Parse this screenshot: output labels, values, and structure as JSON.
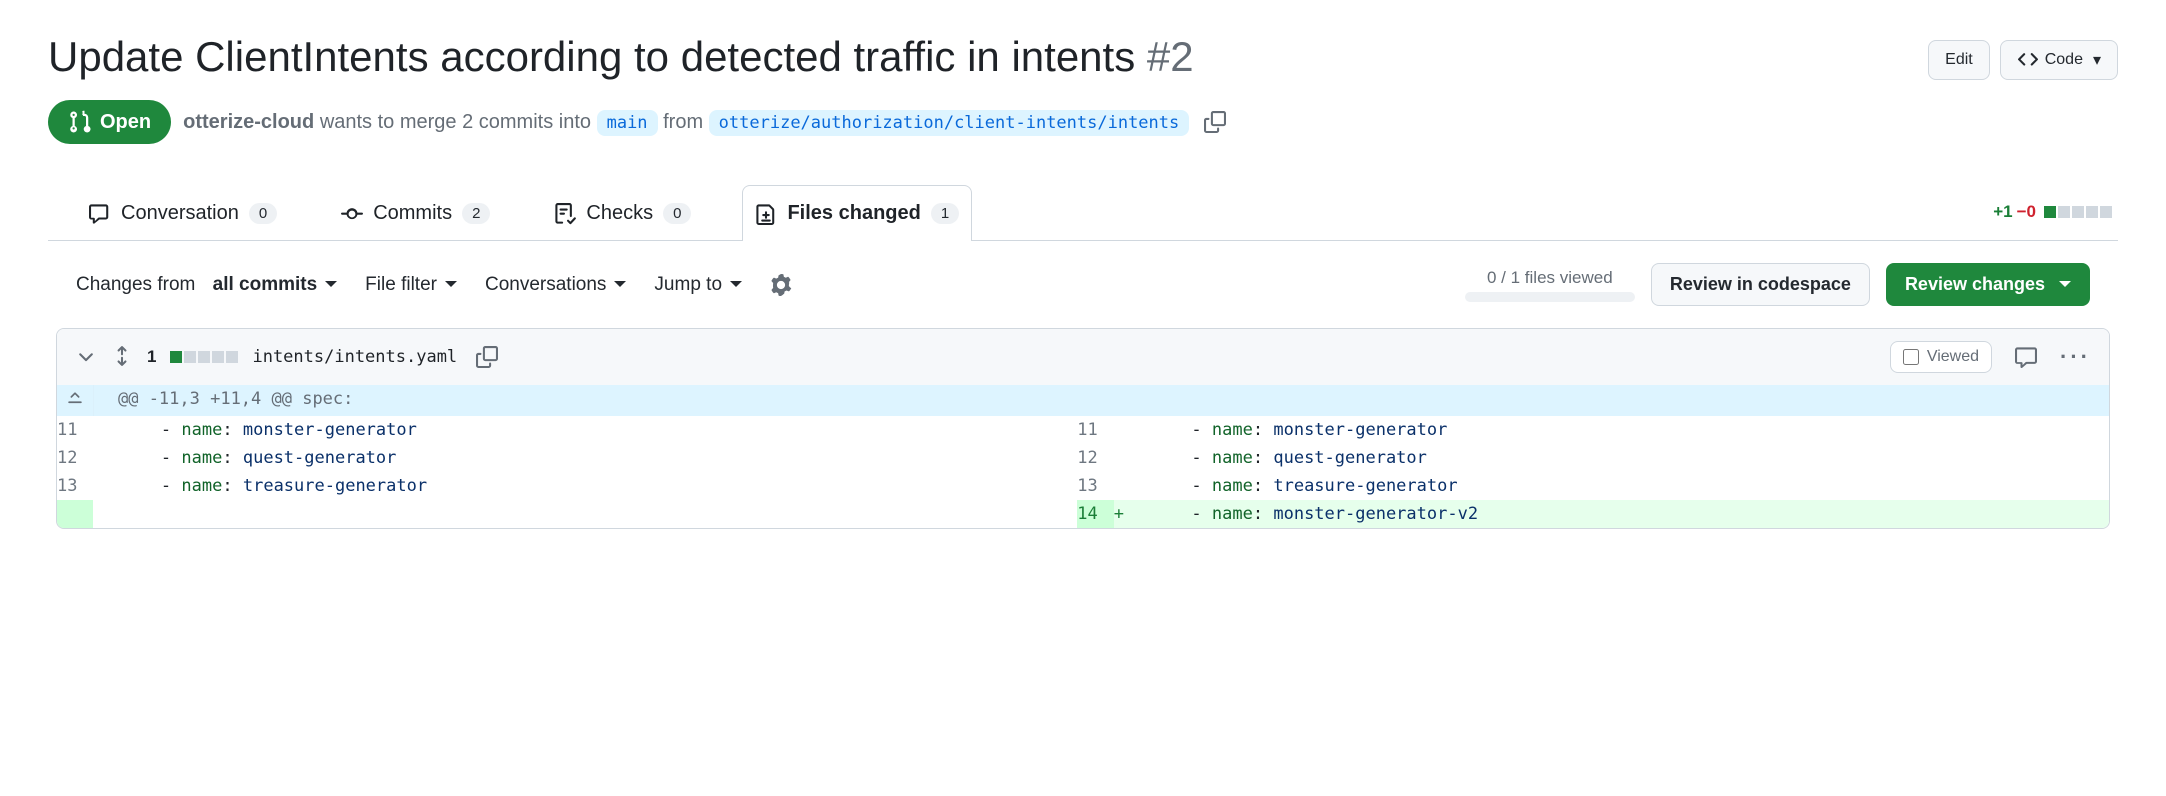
{
  "pr": {
    "title": "Update ClientIntents according to detected traffic in intents",
    "number": "#2",
    "edit_label": "Edit",
    "code_label": "Code",
    "state": "Open",
    "author": "otterize-cloud",
    "merge_text_1": "wants to merge 2 commits into",
    "base_branch": "main",
    "merge_text_2": "from",
    "head_branch": "otterize/authorization/client-intents/intents"
  },
  "tabs": {
    "conversation": {
      "label": "Conversation",
      "count": "0"
    },
    "commits": {
      "label": "Commits",
      "count": "2"
    },
    "checks": {
      "label": "Checks",
      "count": "0"
    },
    "files": {
      "label": "Files changed",
      "count": "1"
    }
  },
  "diffstat": {
    "additions": "+1",
    "deletions": "−0"
  },
  "toolbar": {
    "changes_from": "Changes from",
    "all_commits": "all commits",
    "file_filter": "File filter",
    "conversations": "Conversations",
    "jump_to": "Jump to",
    "files_viewed": "0 / 1 files viewed",
    "review_codespace": "Review in codespace",
    "review_changes": "Review changes"
  },
  "file": {
    "lines_changed": "1",
    "path": "intents/intents.yaml",
    "viewed_label": "Viewed"
  },
  "hunk": "@@ -11,3 +11,4 @@ spec:",
  "diff": {
    "left": [
      {
        "ln": "11",
        "dash": "-",
        "key": "name",
        "colon": ":",
        "val": "monster-generator"
      },
      {
        "ln": "12",
        "dash": "-",
        "key": "name",
        "colon": ":",
        "val": "quest-generator"
      },
      {
        "ln": "13",
        "dash": "-",
        "key": "name",
        "colon": ":",
        "val": "treasure-generator"
      }
    ],
    "right": [
      {
        "ln": "11",
        "dash": "-",
        "key": "name",
        "colon": ":",
        "val": "monster-generator"
      },
      {
        "ln": "12",
        "dash": "-",
        "key": "name",
        "colon": ":",
        "val": "quest-generator"
      },
      {
        "ln": "13",
        "dash": "-",
        "key": "name",
        "colon": ":",
        "val": "treasure-generator"
      },
      {
        "ln": "14",
        "dash": "-",
        "key": "name",
        "colon": ":",
        "val": "monster-generator-v2",
        "add": true
      }
    ]
  }
}
